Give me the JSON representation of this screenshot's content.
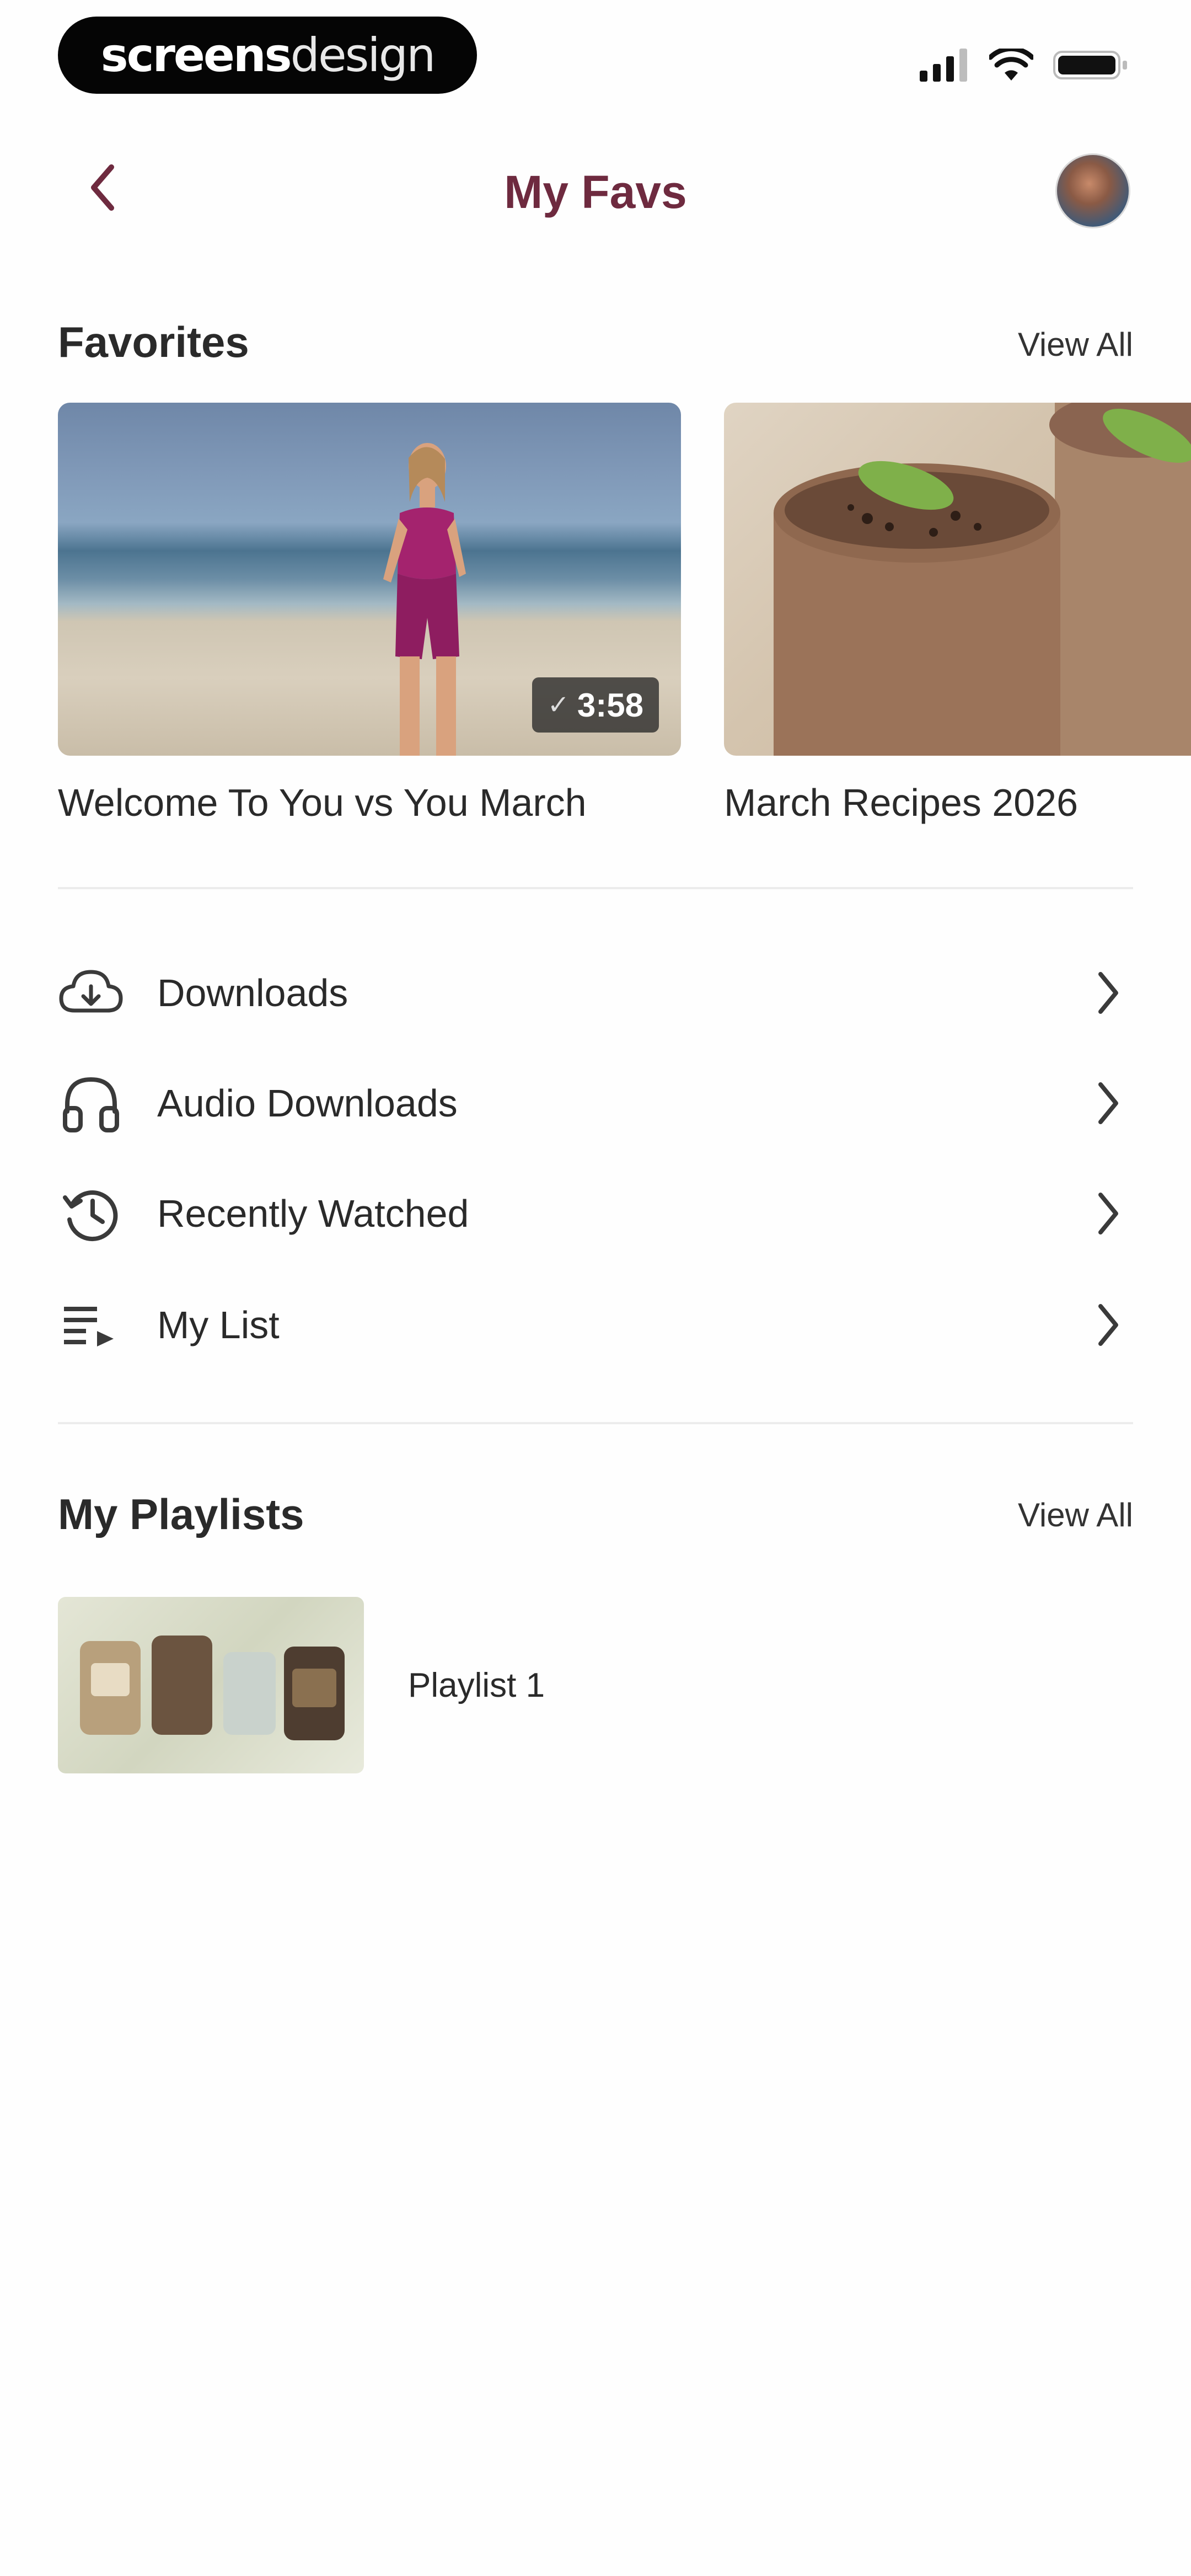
{
  "status_bar": {
    "brand_bold": "screens",
    "brand_light": "design",
    "icons": [
      "cellular-signal-icon",
      "wifi-icon",
      "battery-icon"
    ]
  },
  "header": {
    "title": "My Favs",
    "back_icon": "chevron-left-icon",
    "avatar": "user-avatar"
  },
  "favorites": {
    "title": "Favorites",
    "view_all": "View All",
    "items": [
      {
        "title": "Welcome To You vs You March",
        "duration": "3:58",
        "badge_icon": "check-icon"
      },
      {
        "title": "March Recipes 2026"
      }
    ]
  },
  "menu": {
    "items": [
      {
        "label": "Downloads",
        "icon": "cloud-download-icon"
      },
      {
        "label": "Audio Downloads",
        "icon": "headphones-icon"
      },
      {
        "label": "Recently Watched",
        "icon": "history-icon"
      },
      {
        "label": "My List",
        "icon": "playlist-icon"
      }
    ],
    "chevron_icon": "chevron-right-icon"
  },
  "playlists": {
    "title": "My Playlists",
    "view_all": "View All",
    "items": [
      {
        "name": "Playlist 1"
      }
    ]
  },
  "colors": {
    "accent": "#6e2a3f",
    "text": "#2a2a2a",
    "divider": "#ececec"
  }
}
